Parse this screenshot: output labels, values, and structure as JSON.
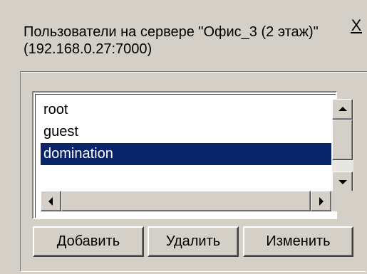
{
  "dialog": {
    "title": "Пользователи на сервере \"Офис_3 (2 этаж)\" (192.168.0.27:7000)",
    "close_label": "X"
  },
  "users": {
    "items": [
      {
        "label": "root",
        "selected": false
      },
      {
        "label": "guest",
        "selected": false
      },
      {
        "label": "domination",
        "selected": true
      },
      {
        "label": "",
        "selected": false
      }
    ],
    "selected_color": "#0a246a"
  },
  "buttons": {
    "add": "Добавить",
    "remove": "Удалить",
    "edit": "Изменить"
  },
  "icons": {
    "scroll_up": "arrow-up-icon",
    "scroll_down": "arrow-down-icon",
    "scroll_left": "arrow-left-icon",
    "scroll_right": "arrow-right-icon"
  }
}
